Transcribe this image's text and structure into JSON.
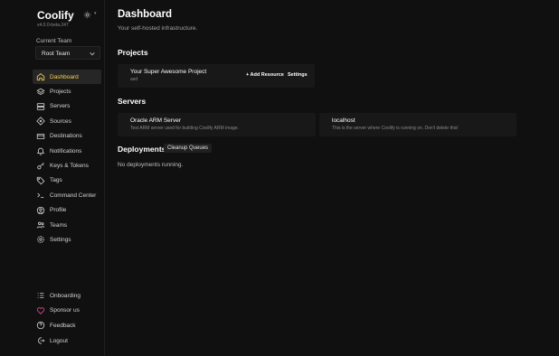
{
  "brand": {
    "name": "Coolify",
    "version": "v4.0.0-beta.247"
  },
  "team": {
    "label": "Current Team",
    "selected": "Root Team"
  },
  "nav": {
    "items": [
      {
        "label": "Dashboard",
        "icon": "home-icon"
      },
      {
        "label": "Projects",
        "icon": "layers-icon"
      },
      {
        "label": "Servers",
        "icon": "server-icon"
      },
      {
        "label": "Sources",
        "icon": "git-icon"
      },
      {
        "label": "Destinations",
        "icon": "destination-icon"
      },
      {
        "label": "Notifications",
        "icon": "bell-icon"
      },
      {
        "label": "Keys & Tokens",
        "icon": "key-icon"
      },
      {
        "label": "Tags",
        "icon": "tag-icon"
      },
      {
        "label": "Command Center",
        "icon": "terminal-icon"
      },
      {
        "label": "Profile",
        "icon": "user-icon"
      },
      {
        "label": "Teams",
        "icon": "users-icon"
      },
      {
        "label": "Settings",
        "icon": "gear-icon"
      }
    ],
    "bottom": [
      {
        "label": "Onboarding",
        "icon": "list-icon"
      },
      {
        "label": "Sponsor us",
        "icon": "heart-icon"
      },
      {
        "label": "Feedback",
        "icon": "help-icon"
      },
      {
        "label": "Logout",
        "icon": "logout-icon"
      }
    ]
  },
  "page": {
    "title": "Dashboard",
    "subtitle": "Your self-hosted infrastructure."
  },
  "projects": {
    "heading": "Projects",
    "items": [
      {
        "name": "Your Super Awesome Project",
        "env": "asd",
        "add_label": "+ Add Resource",
        "settings_label": "Settings"
      }
    ]
  },
  "servers": {
    "heading": "Servers",
    "items": [
      {
        "name": "Oracle ARM Server",
        "description": "Test ARM server used for building Coolify ARM image."
      },
      {
        "name": "localhost",
        "description": "This is the server where Coolify is running on. Don't delete this!"
      }
    ]
  },
  "deployments": {
    "heading": "Deployments",
    "cleanup_label": "Cleanup Queues",
    "empty_text": "No deployments running."
  },
  "colors": {
    "accent": "#fcd34d",
    "bg": "#101010",
    "card": "#181818"
  }
}
